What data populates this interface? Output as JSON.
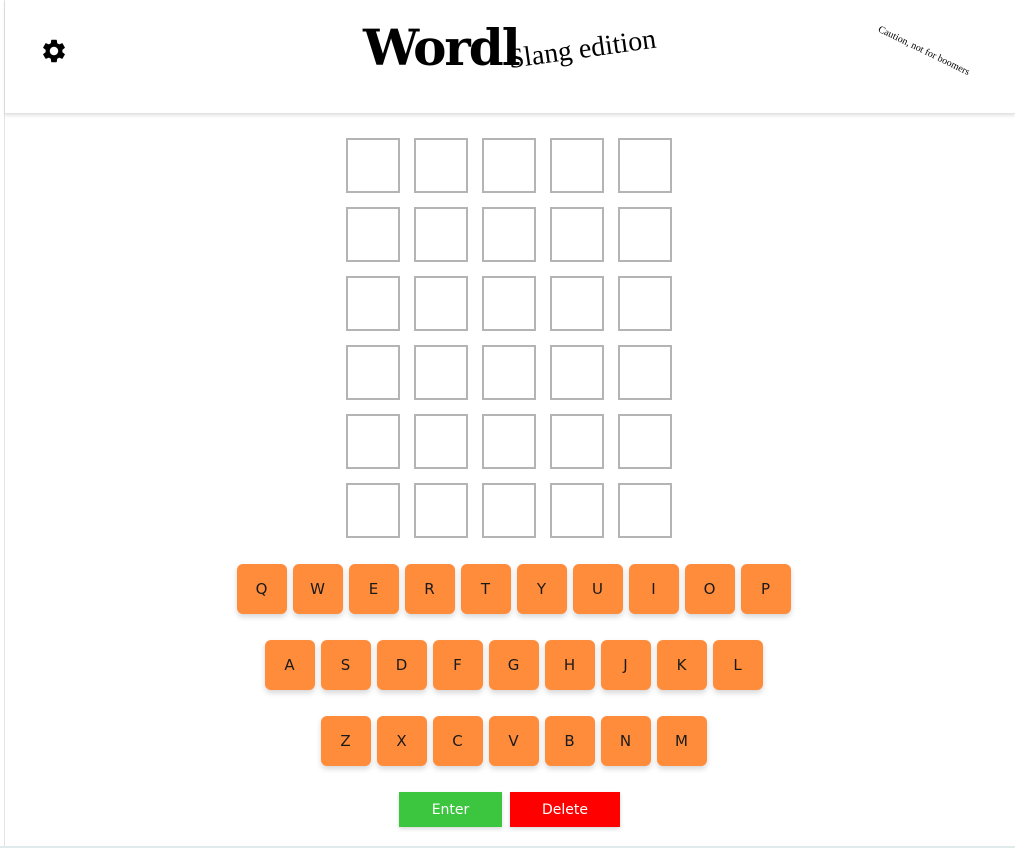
{
  "header": {
    "title": "Wordl",
    "subtitle": "Slang edition",
    "caution": "Caution, not for boomers",
    "settings_icon": "gear-icon"
  },
  "board": {
    "rows": [
      [
        "",
        "",
        "",
        "",
        ""
      ],
      [
        "",
        "",
        "",
        "",
        ""
      ],
      [
        "",
        "",
        "",
        "",
        ""
      ],
      [
        "",
        "",
        "",
        "",
        ""
      ],
      [
        "",
        "",
        "",
        "",
        ""
      ],
      [
        "",
        "",
        "",
        "",
        ""
      ]
    ]
  },
  "keyboard": {
    "row1": [
      "Q",
      "W",
      "E",
      "R",
      "T",
      "Y",
      "U",
      "I",
      "O",
      "P"
    ],
    "row2": [
      "A",
      "S",
      "D",
      "F",
      "G",
      "H",
      "J",
      "K",
      "L"
    ],
    "row3": [
      "Z",
      "X",
      "C",
      "V",
      "B",
      "N",
      "M"
    ]
  },
  "actions": {
    "enter_label": "Enter",
    "delete_label": "Delete"
  },
  "colors": {
    "key": "#ff8c3a",
    "enter": "#3cc53f",
    "delete": "#ff0000",
    "tile_border": "#b4b4b4"
  }
}
